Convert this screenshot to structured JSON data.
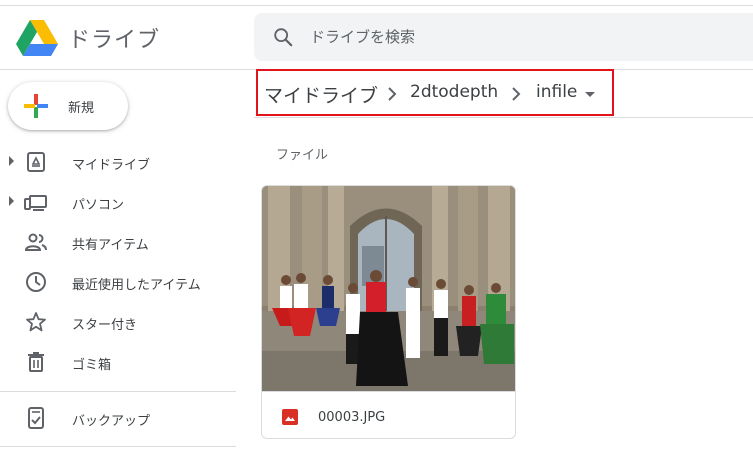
{
  "app": {
    "name": "ドライブ"
  },
  "search": {
    "placeholder": "ドライブを検索",
    "value": ""
  },
  "new_button": {
    "label": "新規"
  },
  "sidebar": {
    "items": [
      {
        "label": "マイドライブ",
        "icon": "my-drive-icon",
        "expandable": true
      },
      {
        "label": "パソコン",
        "icon": "computers-icon",
        "expandable": true
      },
      {
        "label": "共有アイテム",
        "icon": "shared-people-icon",
        "expandable": false
      },
      {
        "label": "最近使用したアイテム",
        "icon": "clock-icon",
        "expandable": false
      },
      {
        "label": "スター付き",
        "icon": "star-icon",
        "expandable": false
      },
      {
        "label": "ゴミ箱",
        "icon": "trash-icon",
        "expandable": false
      }
    ],
    "backup": {
      "label": "バックアップ",
      "icon": "backup-icon"
    }
  },
  "breadcrumb": {
    "items": [
      "マイドライブ",
      "2dtodepth",
      "infile"
    ],
    "highlight_color": "#e2131b"
  },
  "content": {
    "section_label": "ファイル",
    "files": [
      {
        "name": "00003.JPG",
        "type_icon": "image-file-icon",
        "type_color": "#d93025"
      }
    ]
  },
  "colors": {
    "accent_red": "#e2131b",
    "text": "#3c4043",
    "muted": "#5f6368",
    "search_bg": "#f1f3f4"
  }
}
